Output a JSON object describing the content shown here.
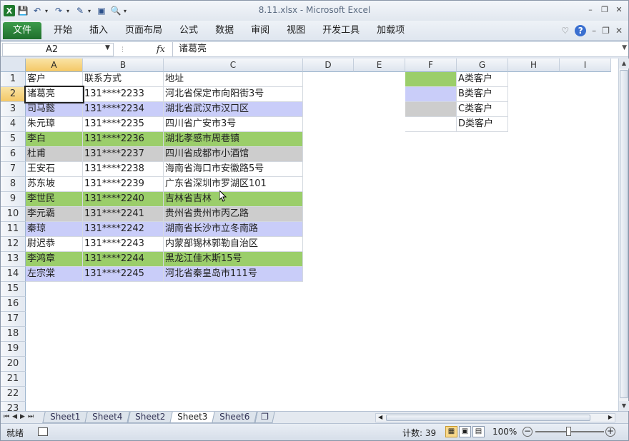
{
  "window": {
    "title": "8.11.xlsx - Microsoft Excel"
  },
  "quick_access": {
    "icons": [
      "excel-logo-icon",
      "save-icon",
      "undo-icon",
      "redo-icon",
      "paste-format-icon",
      "camera-icon",
      "print-preview-icon",
      "customize-qat-icon"
    ]
  },
  "ribbon": {
    "file_tab": "文件",
    "tabs": [
      "开始",
      "插入",
      "页面布局",
      "公式",
      "数据",
      "审阅",
      "视图",
      "开发工具",
      "加载项"
    ]
  },
  "formula_bar": {
    "name_box": "A2",
    "fx_label": "fx",
    "content": "诸葛亮"
  },
  "columns": [
    "A",
    "B",
    "C",
    "D",
    "E",
    "F",
    "G",
    "H",
    "I"
  ],
  "rows": [
    "1",
    "2",
    "3",
    "4",
    "5",
    "6",
    "7",
    "8",
    "9",
    "10",
    "11",
    "12",
    "13",
    "14",
    "15",
    "16",
    "17",
    "18",
    "19",
    "20",
    "21",
    "22",
    "23"
  ],
  "colors": {
    "green": "#9bce6a",
    "blue": "#c9cdf9",
    "gray": "#cdcdcd",
    "white": "#ffffff"
  },
  "table": {
    "header": [
      "客户",
      "联系方式",
      "地址"
    ],
    "records": [
      {
        "name": "诸葛亮",
        "phone": "131****2233",
        "address": "河北省保定市向阳街3号",
        "fill": "white"
      },
      {
        "name": "司马懿",
        "phone": "131****2234",
        "address": "湖北省武汉市汉口区",
        "fill": "blue"
      },
      {
        "name": "朱元璋",
        "phone": "131****2235",
        "address": "四川省广安市3号",
        "fill": "white"
      },
      {
        "name": "李白",
        "phone": "131****2236",
        "address": "湖北孝感市周巷镇",
        "fill": "green"
      },
      {
        "name": "杜甫",
        "phone": "131****2237",
        "address": "四川省成都市小酒馆",
        "fill": "gray"
      },
      {
        "name": "王安石",
        "phone": "131****2238",
        "address": "海南省海口市安徽路5号",
        "fill": "white"
      },
      {
        "name": "苏东坡",
        "phone": "131****2239",
        "address": "广东省深圳市罗湖区101",
        "fill": "white"
      },
      {
        "name": "李世民",
        "phone": "131****2240",
        "address": "吉林省吉林",
        "fill": "green"
      },
      {
        "name": "李元霸",
        "phone": "131****2241",
        "address": "贵州省贵州市丙乙路",
        "fill": "gray"
      },
      {
        "name": "秦琼",
        "phone": "131****2242",
        "address": "湖南省长沙市立冬南路",
        "fill": "blue"
      },
      {
        "name": "尉迟恭",
        "phone": "131****2243",
        "address": "内蒙部锡林郭勒自治区",
        "fill": "white"
      },
      {
        "name": "李鸿章",
        "phone": "131****2244",
        "address": "黑龙江佳木斯15号",
        "fill": "green"
      },
      {
        "name": "左宗棠",
        "phone": "131****2245",
        "address": "河北省秦皇岛市111号",
        "fill": "blue"
      }
    ]
  },
  "legend": [
    {
      "fill": "green",
      "label": "A类客户"
    },
    {
      "fill": "blue",
      "label": "B类客户"
    },
    {
      "fill": "gray",
      "label": "C类客户"
    },
    {
      "fill": "white",
      "label": "D类客户"
    }
  ],
  "sheets": {
    "tabs": [
      "Sheet1",
      "Sheet4",
      "Sheet2",
      "Sheet3",
      "Sheet6"
    ],
    "active": "Sheet3"
  },
  "status": {
    "ready": "就绪",
    "count": "计数: 39",
    "zoom": "100%"
  }
}
